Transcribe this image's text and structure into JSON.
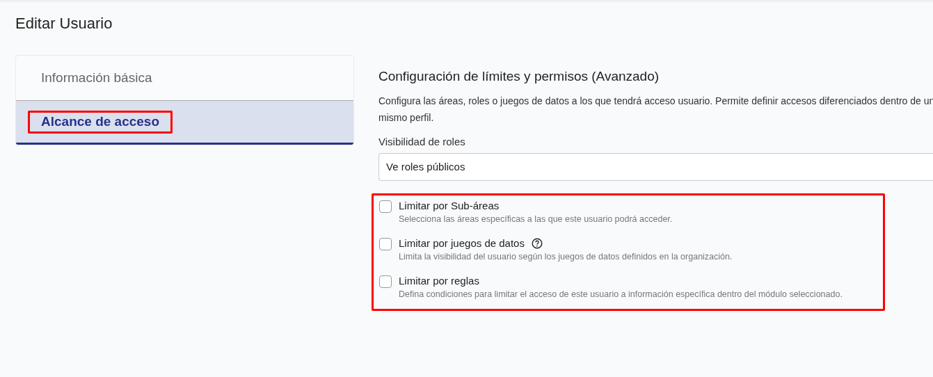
{
  "page": {
    "title": "Editar Usuario"
  },
  "tabs": [
    {
      "label": "Información básica",
      "selected": false,
      "highlighted": false
    },
    {
      "label": "Alcance de acceso",
      "selected": true,
      "highlighted": true
    }
  ],
  "section": {
    "title": "Configuración de límites y permisos (Avanzado)",
    "description": "Configura las áreas, roles o juegos de datos a los que tendrá acceso usuario. Permite definir accesos diferenciados dentro de un mismo perfil."
  },
  "role_visibility": {
    "label": "Visibilidad de roles",
    "value": "Ve roles públicos"
  },
  "limits": {
    "highlighted": true,
    "options": [
      {
        "label": "Limitar por Sub-áreas",
        "description": "Selecciona las áreas específicas a las que este usuario podrá acceder.",
        "checked": false,
        "has_help": false
      },
      {
        "label": "Limitar por juegos de datos",
        "description": "Limita la visibilidad del usuario según los juegos de datos definidos en la organización.",
        "checked": false,
        "has_help": true
      },
      {
        "label": "Limitar por reglas",
        "description": "Defina condiciones para limitar el acceso de este usuario a información específica dentro del módulo seleccionado.",
        "checked": false,
        "has_help": false
      }
    ]
  }
}
